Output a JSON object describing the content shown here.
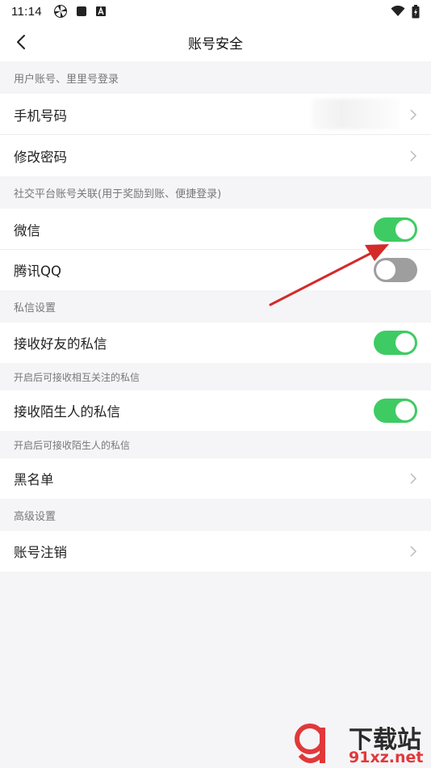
{
  "status_bar": {
    "time": "11:14",
    "icons": [
      "pinwheel-icon",
      "square-icon",
      "a-badge-icon",
      "wifi-icon",
      "battery-icon"
    ]
  },
  "nav": {
    "title": "账号安全",
    "back_icon": "back-chevron-icon"
  },
  "sections": {
    "login": {
      "header": "用户账号、里里号登录",
      "phone_label": "手机号码",
      "password_label": "修改密码"
    },
    "social": {
      "header": "社交平台账号关联(用于奖励到账、便捷登录)",
      "wechat_label": "微信",
      "wechat_on": true,
      "qq_label": "腾讯QQ",
      "qq_on": false
    },
    "pm": {
      "header": "私信设置",
      "friends_label": "接收好友的私信",
      "friends_on": true,
      "friends_note": "开启后可接收相互关注的私信",
      "strangers_label": "接收陌生人的私信",
      "strangers_on": true,
      "strangers_note": "开启后可接收陌生人的私信",
      "blacklist_label": "黑名单"
    },
    "advanced": {
      "header": "高级设置",
      "cancel_label": "账号注销"
    }
  },
  "colors": {
    "toggle_on": "#3ecb63",
    "toggle_off": "#9e9e9e",
    "annotation_arrow": "#d42a2a"
  },
  "watermark": {
    "text_main": "下载站",
    "text_sub": "91xz.net"
  }
}
